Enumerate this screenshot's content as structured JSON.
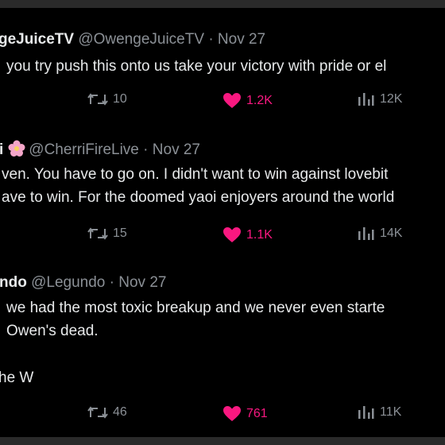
{
  "tweets": [
    {
      "name": "geJuiceTV",
      "handle": "@OwengeJuiceTV",
      "date": "Nov 27",
      "lines": [
        "you try push this onto us take your victory with pride or el"
      ],
      "replies": "10",
      "likes": "1.2K",
      "views": "12K"
    },
    {
      "name": "i",
      "handle": "@CherriFireLive",
      "date": "Nov 27",
      "lines": [
        "ven. You have to go on. I didn't want to win against lovebit",
        "ave to win. For the doomed yaoi enjoyers around the world"
      ],
      "replies": "15",
      "likes": "1.1K",
      "views": "14K"
    },
    {
      "name": "ndo",
      "handle": "@Legundo",
      "date": "Nov 27",
      "lines": [
        "we had the most toxic breakup and we never even starte",
        "Owen's dead.",
        "",
        "he W"
      ],
      "replies": "46",
      "likes": "761",
      "views": "11K"
    }
  ],
  "separator": "·",
  "icons": {
    "reply": "retweet-icon",
    "like": "heart-icon",
    "views": "views-icon"
  },
  "colors": {
    "like": "#f91880",
    "muted": "#8b9096",
    "text": "#e7e9ea"
  }
}
